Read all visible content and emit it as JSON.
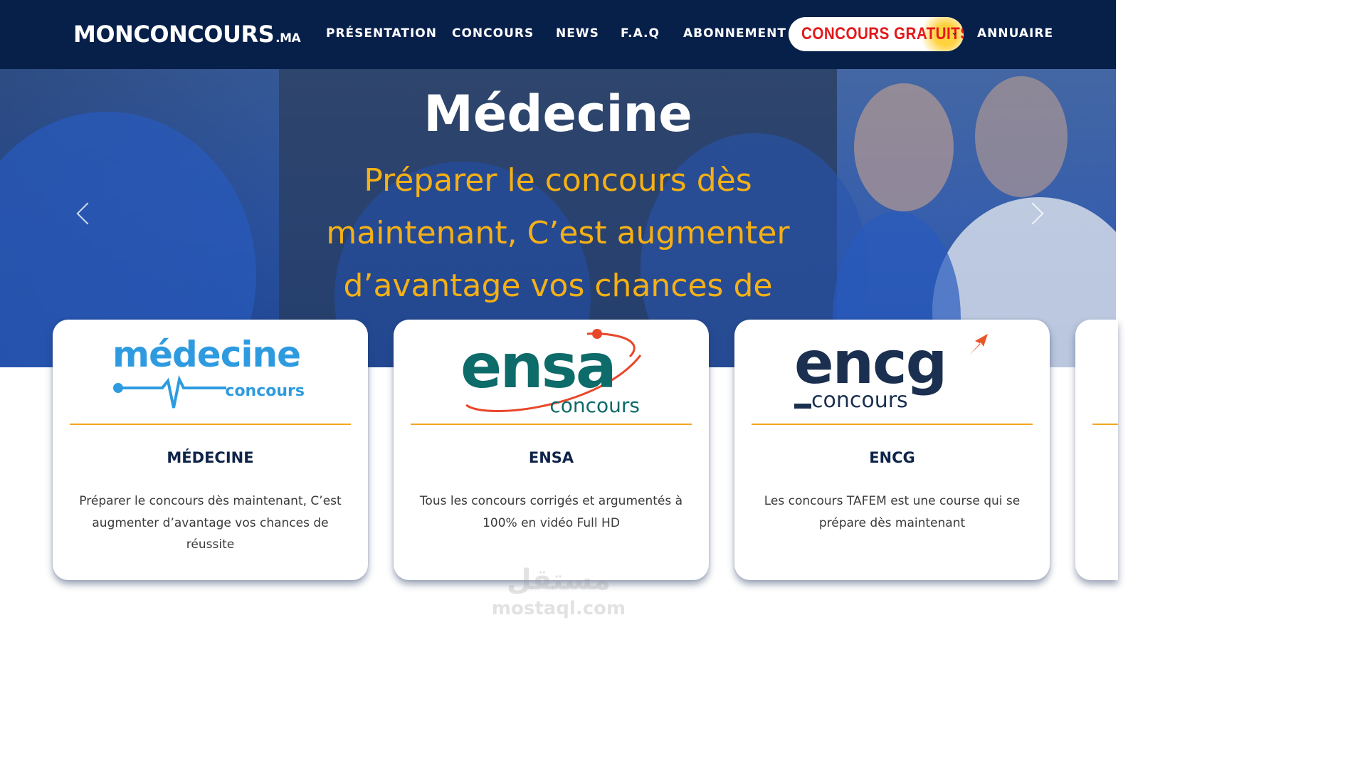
{
  "nav": {
    "logo_main": "MONCONCOURS",
    "logo_suffix": ".MA",
    "items": [
      "PRÉSENTATION",
      "CONCOURS",
      "NEWS",
      "F.A.Q",
      "ABONNEMENT"
    ],
    "highlight": "CONCOURS GRATUITS",
    "last_item": "ANNUAIRE"
  },
  "hero": {
    "title": "Médecine",
    "subtitle": "Préparer le concours dès maintenant, C’est augmenter d’avantage vos chances de réussite"
  },
  "cards": [
    {
      "logo_word": "médecine",
      "logo_sub": "concours",
      "title": "MÉDECINE",
      "description": "Préparer le concours dès maintenant, C’est augmenter d’avantage vos chances de réussite"
    },
    {
      "logo_word": "ensa",
      "logo_sub": "concours",
      "title": "ENSA",
      "description": "Tous les concours corrigés et argumentés à 100% en vidéo Full HD"
    },
    {
      "logo_word": "encg",
      "logo_sub": "concours",
      "title": "ENCG",
      "description": "Les concours TAFEM est une course qui se prépare dès maintenant"
    }
  ],
  "watermark": {
    "arabic": "مستقل",
    "latin": "mostaql.com"
  },
  "colors": {
    "nav_bg": "#07204a",
    "accent": "#f5a623",
    "hero_sub": "#f5b016",
    "highlight_text": "#e3191b"
  }
}
